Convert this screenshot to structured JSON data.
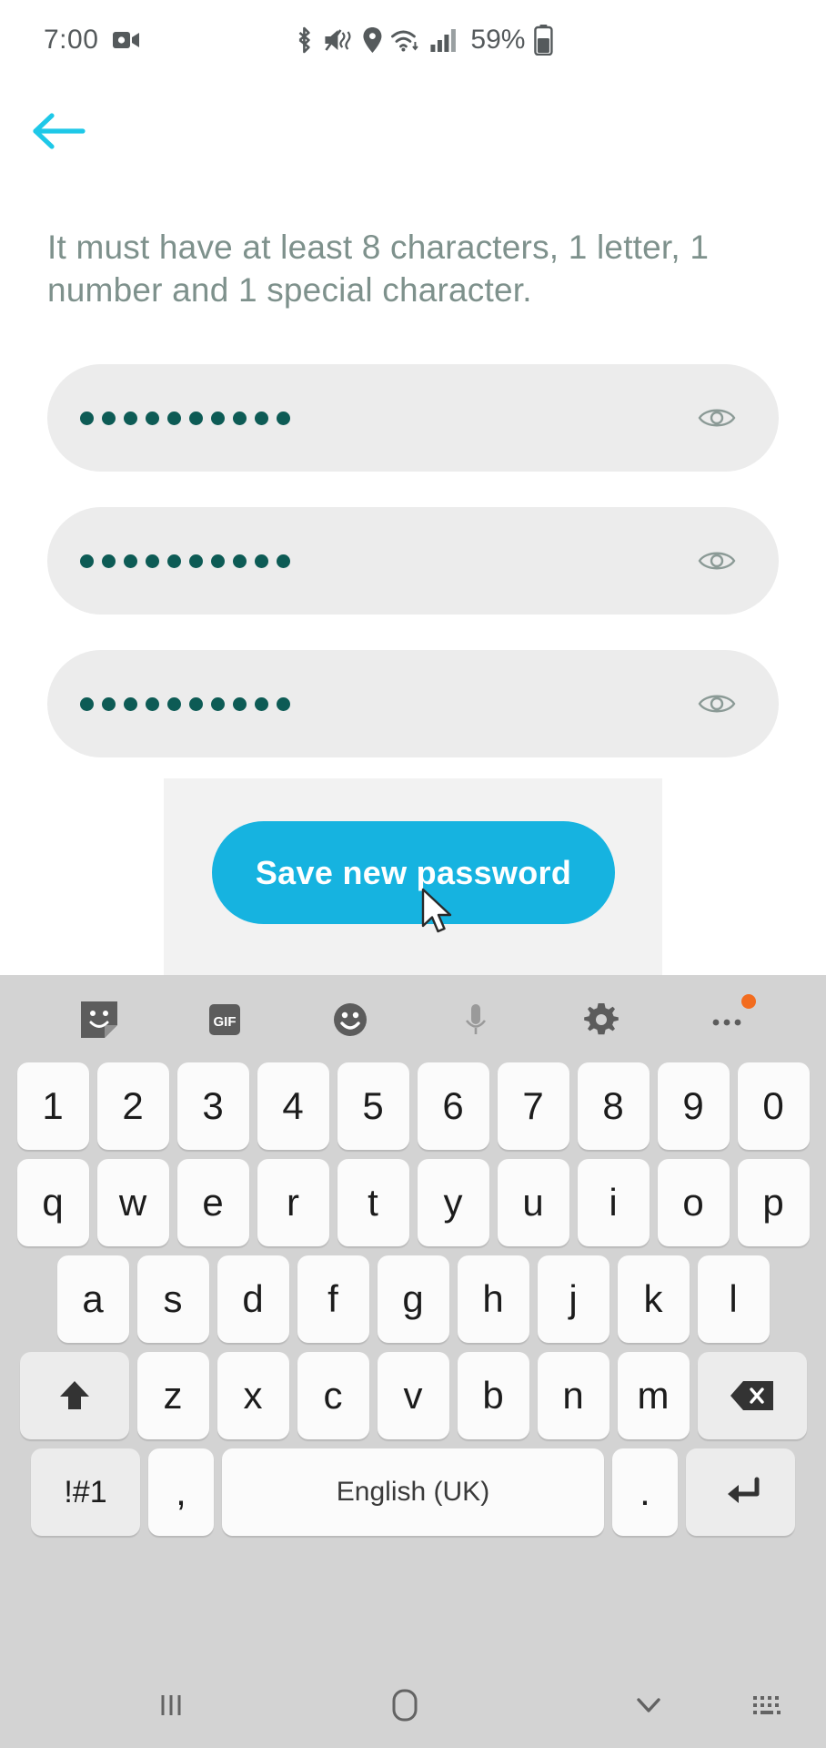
{
  "status_bar": {
    "time": "7:00",
    "battery_percent": "59%",
    "icons": [
      "screen-record-icon",
      "bluetooth-icon",
      "vibrate-mute-icon",
      "location-icon",
      "wifi-icon",
      "cellular-signal-icon",
      "battery-icon"
    ]
  },
  "header": {
    "back_icon": "back-arrow-icon"
  },
  "main": {
    "instruction": "It must have at least 8 characters, 1 letter, 1 number and 1 special character.",
    "fields": [
      {
        "name": "current-password",
        "masked_value": "••••••••••",
        "dot_count": 10,
        "toggle_icon": "eye-icon"
      },
      {
        "name": "new-password",
        "masked_value": "••••••••••",
        "dot_count": 10,
        "toggle_icon": "eye-icon"
      },
      {
        "name": "confirm-password",
        "masked_value": "••••••••••",
        "dot_count": 10,
        "toggle_icon": "eye-icon"
      }
    ],
    "save_button": "Save new password"
  },
  "keyboard": {
    "toolbar": [
      "sticker-icon",
      "gif-icon",
      "emoji-icon",
      "microphone-icon",
      "settings-gear-icon",
      "more-options-icon"
    ],
    "row_numbers": [
      "1",
      "2",
      "3",
      "4",
      "5",
      "6",
      "7",
      "8",
      "9",
      "0"
    ],
    "row_q": [
      "q",
      "w",
      "e",
      "r",
      "t",
      "y",
      "u",
      "i",
      "o",
      "p"
    ],
    "row_a": [
      "a",
      "s",
      "d",
      "f",
      "g",
      "h",
      "j",
      "k",
      "l"
    ],
    "row_z": [
      "z",
      "x",
      "c",
      "v",
      "b",
      "n",
      "m"
    ],
    "shift_icon": "shift-arrow-icon",
    "backspace_icon": "backspace-icon",
    "symbols_key": "!#1",
    "comma_key": ",",
    "space_key": "English (UK)",
    "period_key": ".",
    "enter_icon": "enter-return-icon"
  },
  "nav_bar": {
    "recents_icon": "recents-icon",
    "home_icon": "home-icon",
    "back_down_icon": "hide-keyboard-chevron-icon",
    "keyboard_switch_icon": "keyboard-switch-icon"
  },
  "colors": {
    "accent": "#16b3e0",
    "instruction_text": "#7e918c",
    "field_bg": "#ececec",
    "dot": "#0d5b55",
    "keyboard_bg": "#d3d3d3"
  }
}
